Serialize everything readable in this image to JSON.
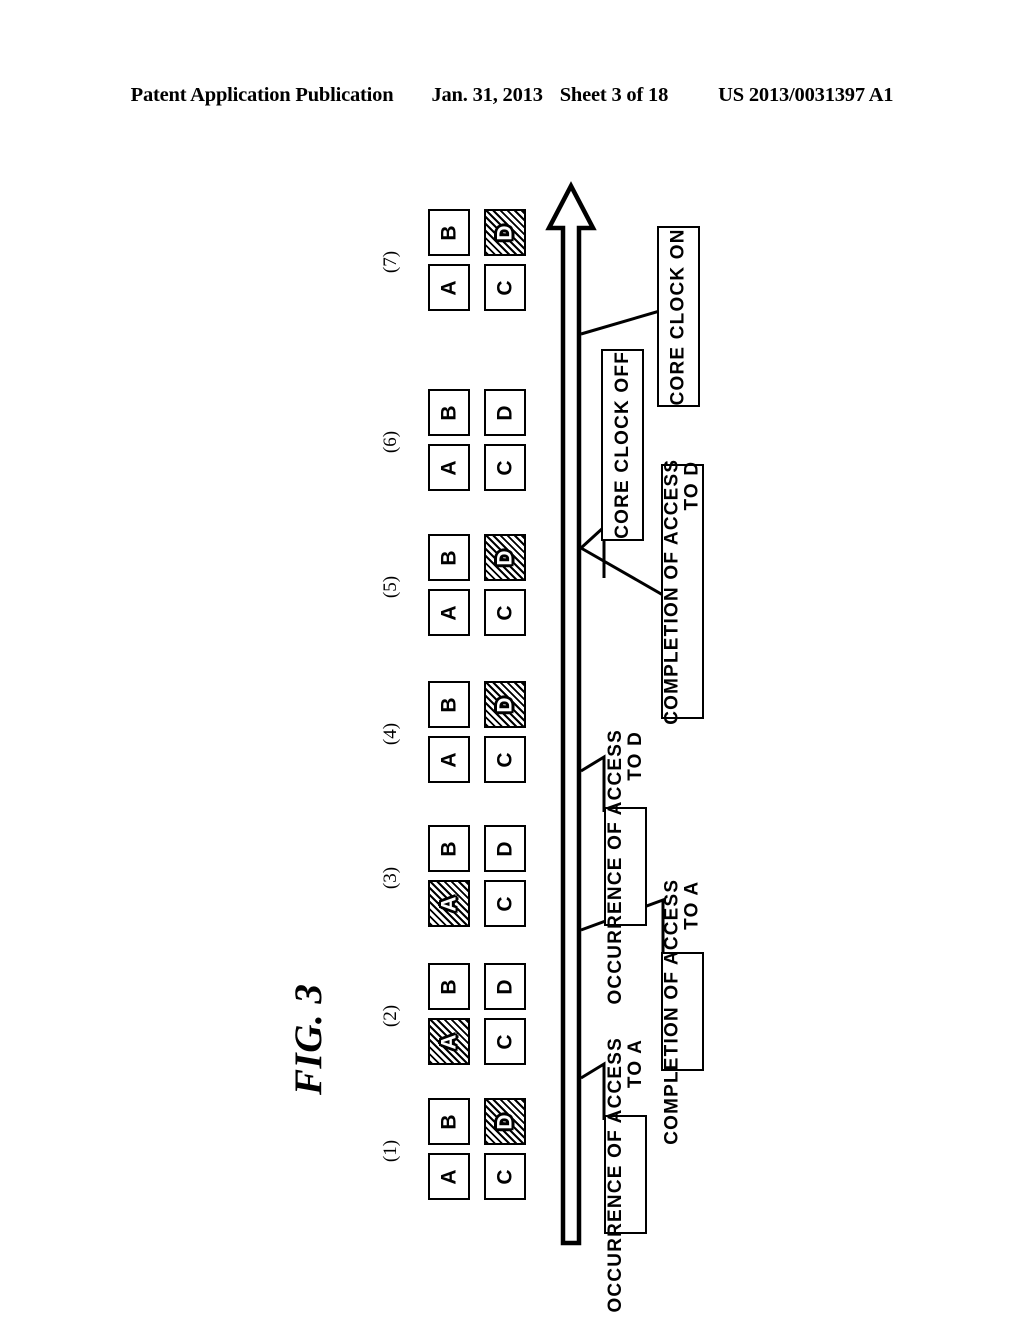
{
  "header": {
    "publication": "Patent Application Publication",
    "date": "Jan. 31, 2013",
    "sheet": "Sheet 3 of 18",
    "patent_number": "US 2013/0031397 A1"
  },
  "figure": {
    "label": "FIG. 3",
    "timeline_axis_name": "time-arrow"
  },
  "colors": {
    "ink": "#000000",
    "paper": "#ffffff",
    "hatch": "#000000"
  },
  "state_groups": [
    {
      "index": "(1)",
      "cells": [
        {
          "id": "A",
          "label": "A",
          "hatched": false
        },
        {
          "id": "B",
          "label": "B",
          "hatched": false
        },
        {
          "id": "C",
          "label": "C",
          "hatched": false
        },
        {
          "id": "D",
          "label": "D",
          "hatched": true
        }
      ]
    },
    {
      "index": "(2)",
      "cells": [
        {
          "id": "A",
          "label": "A",
          "hatched": true
        },
        {
          "id": "B",
          "label": "B",
          "hatched": false
        },
        {
          "id": "C",
          "label": "C",
          "hatched": false
        },
        {
          "id": "D",
          "label": "D",
          "hatched": false
        }
      ]
    },
    {
      "index": "(3)",
      "cells": [
        {
          "id": "A",
          "label": "A",
          "hatched": true
        },
        {
          "id": "B",
          "label": "B",
          "hatched": false
        },
        {
          "id": "C",
          "label": "C",
          "hatched": false
        },
        {
          "id": "D",
          "label": "D",
          "hatched": false
        }
      ]
    },
    {
      "index": "(4)",
      "cells": [
        {
          "id": "A",
          "label": "A",
          "hatched": false
        },
        {
          "id": "B",
          "label": "B",
          "hatched": false
        },
        {
          "id": "C",
          "label": "C",
          "hatched": false
        },
        {
          "id": "D",
          "label": "D",
          "hatched": true
        }
      ]
    },
    {
      "index": "(5)",
      "cells": [
        {
          "id": "A",
          "label": "A",
          "hatched": false
        },
        {
          "id": "B",
          "label": "B",
          "hatched": false
        },
        {
          "id": "C",
          "label": "C",
          "hatched": false
        },
        {
          "id": "D",
          "label": "D",
          "hatched": true
        }
      ]
    },
    {
      "index": "(6)",
      "cells": [
        {
          "id": "A",
          "label": "A",
          "hatched": false
        },
        {
          "id": "B",
          "label": "B",
          "hatched": false
        },
        {
          "id": "C",
          "label": "C",
          "hatched": false
        },
        {
          "id": "D",
          "label": "D",
          "hatched": false
        }
      ]
    },
    {
      "index": "(7)",
      "cells": [
        {
          "id": "A",
          "label": "A",
          "hatched": false
        },
        {
          "id": "B",
          "label": "B",
          "hatched": false
        },
        {
          "id": "C",
          "label": "C",
          "hatched": false
        },
        {
          "id": "D",
          "label": "D",
          "hatched": true
        }
      ]
    }
  ],
  "callouts": [
    {
      "id": "occurrence-access-a",
      "line1": "OCCURRENCE OF ACCESS",
      "line2": "TO A"
    },
    {
      "id": "completion-access-a",
      "line1": "COMPLETION OF ACCESS",
      "line2": "TO A"
    },
    {
      "id": "occurrence-access-d",
      "line1": "OCCURRENCE OF ACCESS",
      "line2": "TO D"
    },
    {
      "id": "completion-access-d",
      "line1": "COMPLETION OF ACCESS",
      "line2": "TO D"
    },
    {
      "id": "core-clock-off",
      "line1": "CORE CLOCK OFF",
      "line2": ""
    },
    {
      "id": "core-clock-on",
      "line1": "CORE CLOCK ON",
      "line2": ""
    }
  ]
}
